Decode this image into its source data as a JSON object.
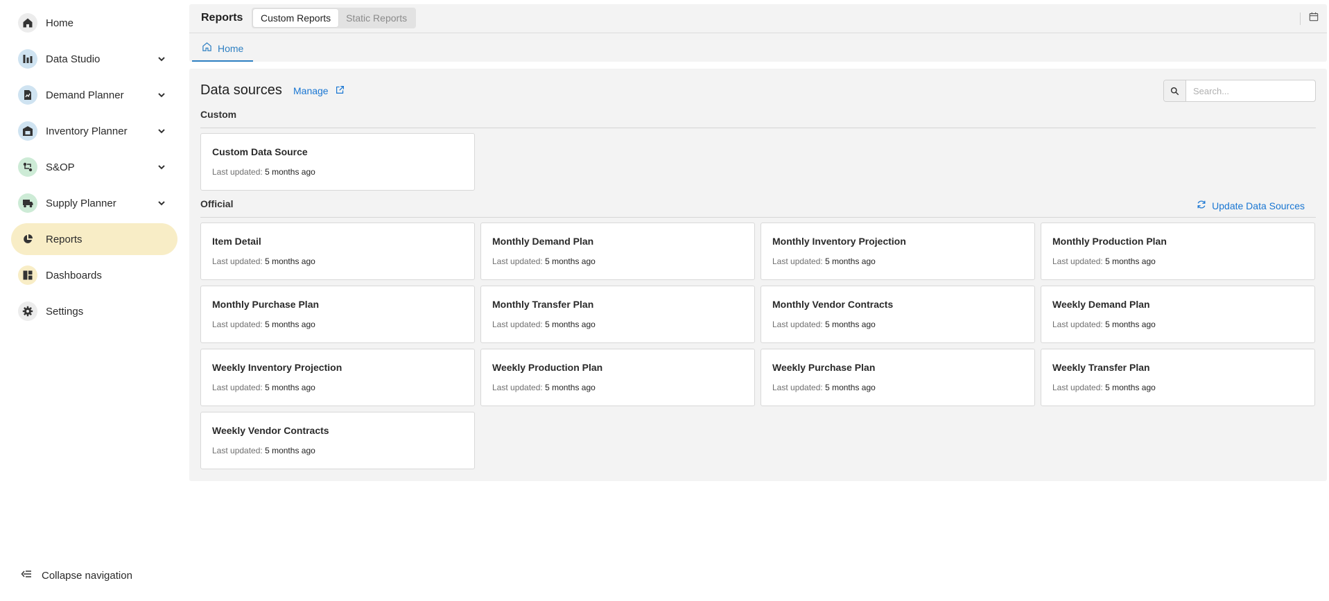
{
  "nav": {
    "items": [
      {
        "label": "Home",
        "icon": "home-icon",
        "has_chevron": false,
        "active": false,
        "icon_bg": "#ececec"
      },
      {
        "label": "Data Studio",
        "icon": "data-studio-icon",
        "has_chevron": true,
        "active": false,
        "icon_bg": "#cfe3f1"
      },
      {
        "label": "Demand Planner",
        "icon": "demand-planner-icon",
        "has_chevron": true,
        "active": false,
        "icon_bg": "#cfe3f1"
      },
      {
        "label": "Inventory Planner",
        "icon": "inventory-planner-icon",
        "has_chevron": true,
        "active": false,
        "icon_bg": "#cfe3f1"
      },
      {
        "label": "S&OP",
        "icon": "sop-icon",
        "has_chevron": true,
        "active": false,
        "icon_bg": "#cdebd6"
      },
      {
        "label": "Supply Planner",
        "icon": "supply-planner-icon",
        "has_chevron": true,
        "active": false,
        "icon_bg": "#cdebd6"
      },
      {
        "label": "Reports",
        "icon": "reports-icon",
        "has_chevron": false,
        "active": true,
        "icon_bg": "#f8edc6"
      },
      {
        "label": "Dashboards",
        "icon": "dashboards-icon",
        "has_chevron": false,
        "active": false,
        "icon_bg": "#f8edc6"
      },
      {
        "label": "Settings",
        "icon": "settings-icon",
        "has_chevron": false,
        "active": false,
        "icon_bg": "#ececec"
      }
    ],
    "collapse_label": "Collapse navigation"
  },
  "header": {
    "title": "Reports",
    "tabs": [
      {
        "label": "Custom Reports",
        "active": true
      },
      {
        "label": "Static Reports",
        "active": false
      }
    ],
    "home_tab": "Home"
  },
  "data_sources": {
    "title": "Data sources",
    "manage_label": "Manage",
    "search_placeholder": "Search...",
    "custom_heading": "Custom",
    "official_heading": "Official",
    "update_label": "Update Data Sources",
    "meta_label": "Last updated:",
    "custom": [
      {
        "name": "Custom Data Source",
        "updated": "5 months ago"
      }
    ],
    "official": [
      {
        "name": "Item Detail",
        "updated": "5 months ago"
      },
      {
        "name": "Monthly Demand Plan",
        "updated": "5 months ago"
      },
      {
        "name": "Monthly Inventory Projection",
        "updated": "5 months ago"
      },
      {
        "name": "Monthly Production Plan",
        "updated": "5 months ago"
      },
      {
        "name": "Monthly Purchase Plan",
        "updated": "5 months ago"
      },
      {
        "name": "Monthly Transfer Plan",
        "updated": "5 months ago"
      },
      {
        "name": "Monthly Vendor Contracts",
        "updated": "5 months ago"
      },
      {
        "name": "Weekly Demand Plan",
        "updated": "5 months ago"
      },
      {
        "name": "Weekly Inventory Projection",
        "updated": "5 months ago"
      },
      {
        "name": "Weekly Production Plan",
        "updated": "5 months ago"
      },
      {
        "name": "Weekly Purchase Plan",
        "updated": "5 months ago"
      },
      {
        "name": "Weekly Transfer Plan",
        "updated": "5 months ago"
      },
      {
        "name": "Weekly Vendor Contracts",
        "updated": "5 months ago"
      }
    ]
  },
  "colors": {
    "accent": "#1976d2",
    "active_nav": "#f8edc6"
  }
}
